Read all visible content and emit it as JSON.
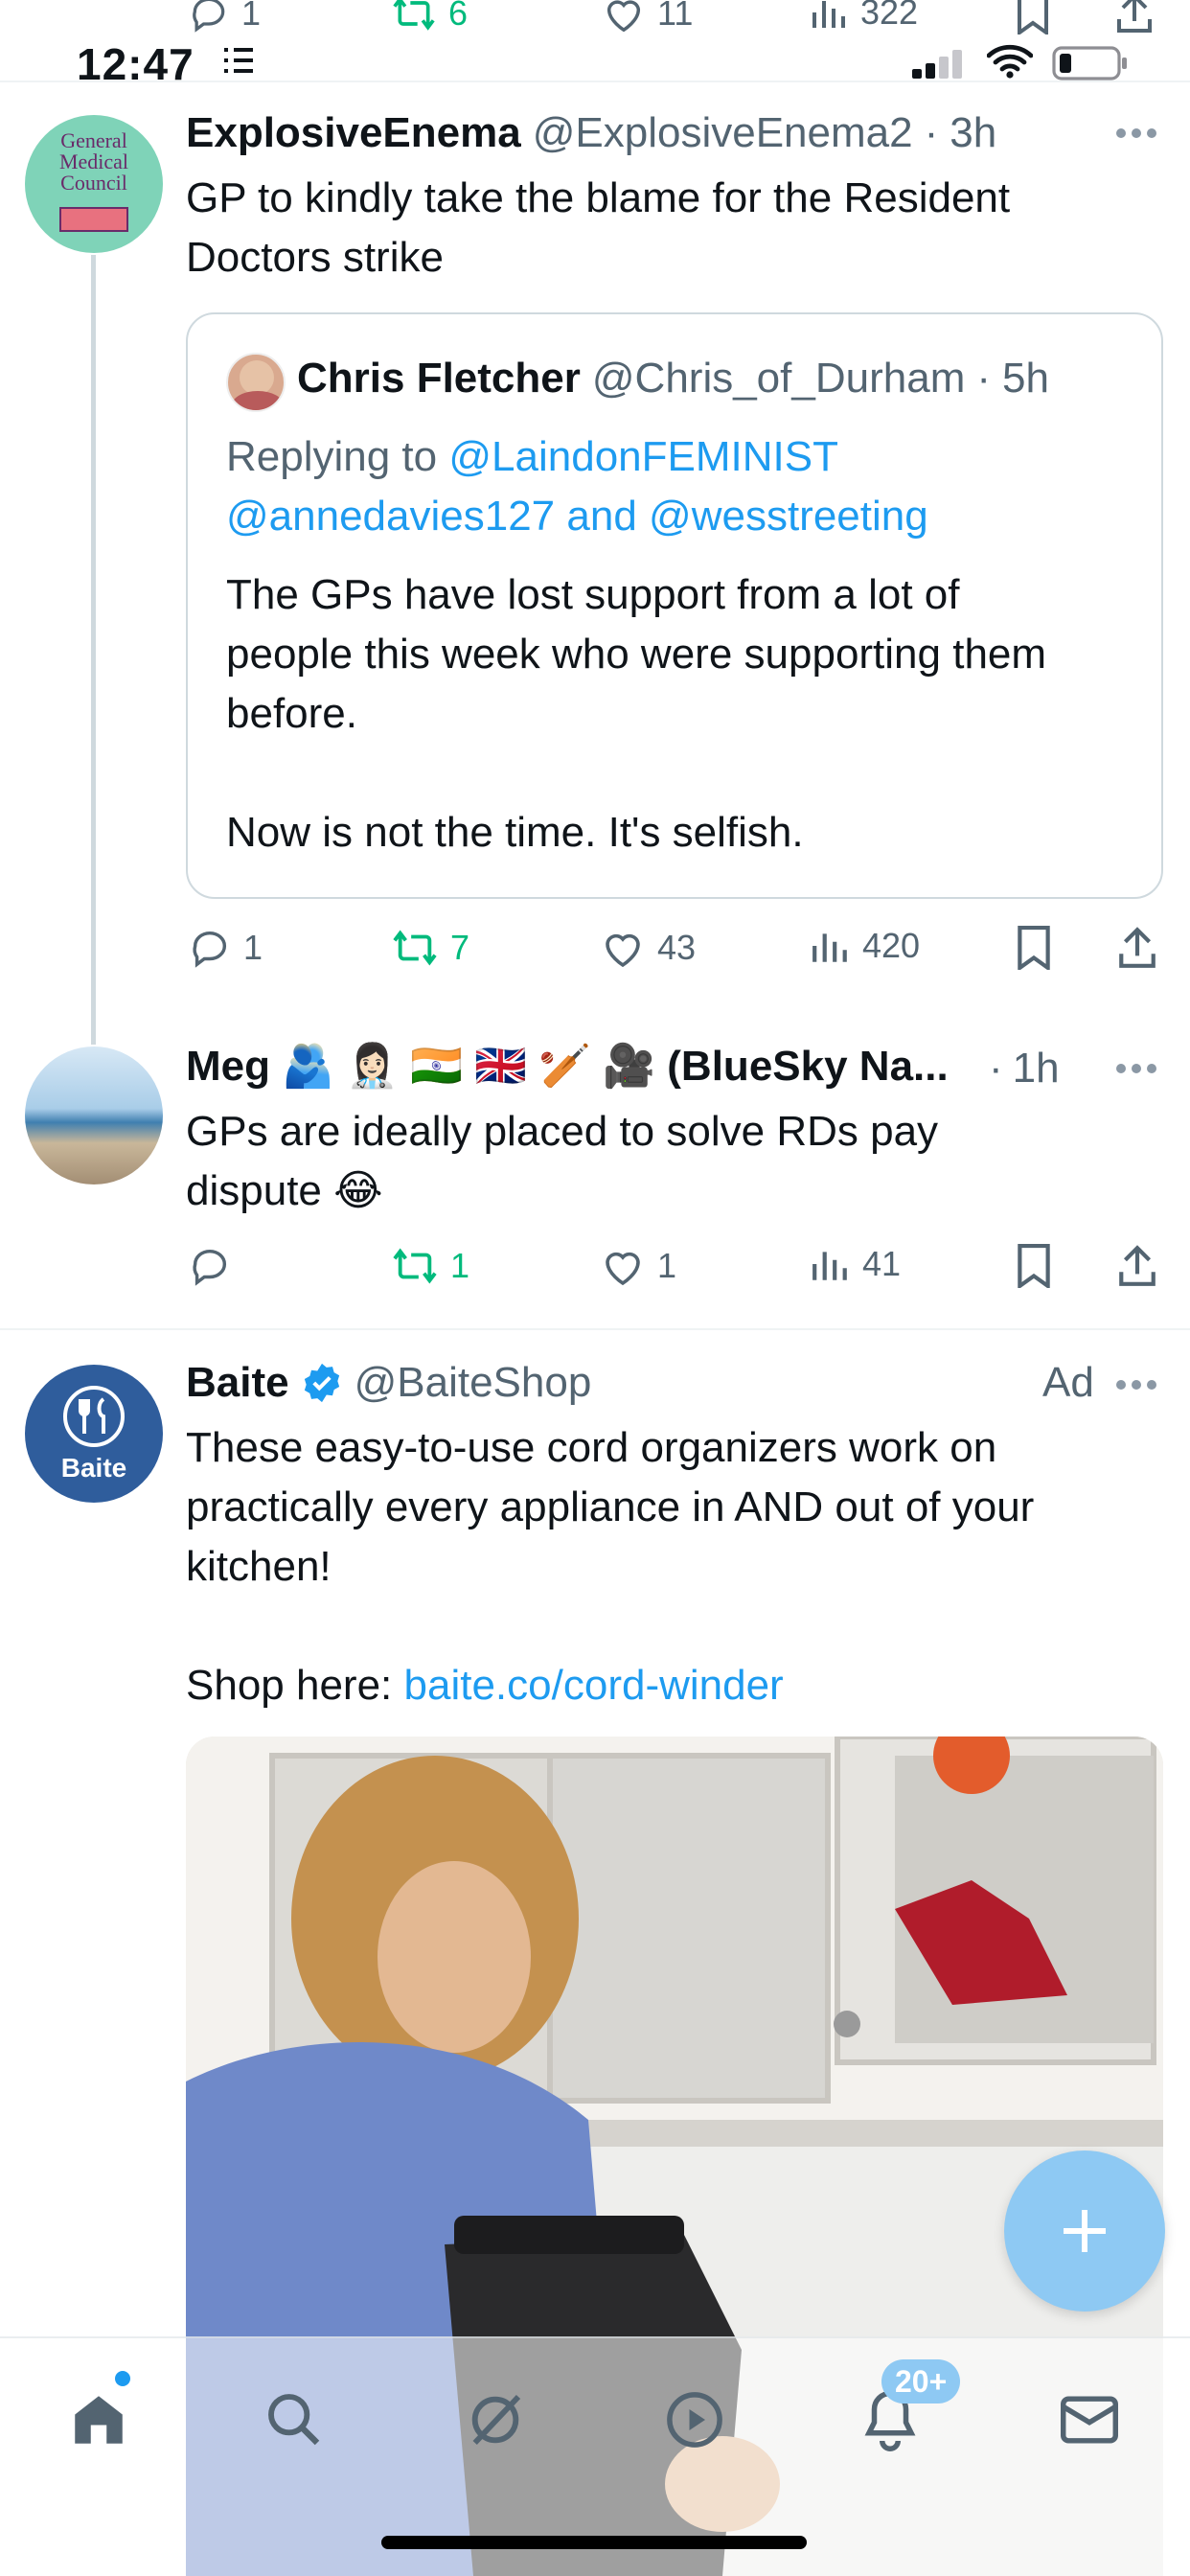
{
  "status_bar": {
    "time": "12:47"
  },
  "previous_tweet_actions": {
    "replies": "1",
    "reposts": "6",
    "likes": "11",
    "views": "322"
  },
  "tweet1": {
    "display_name": "ExplosiveEnema",
    "handle": "@ExplosiveEnema2",
    "age": "3h",
    "avatar_text": [
      "General",
      "Medical",
      "Council"
    ],
    "text": "GP to kindly take the blame for the Resident Doctors strike",
    "quote": {
      "display_name": "Chris Fletcher",
      "handle": "@Chris_of_Durham",
      "age": "5h",
      "replying_prefix": "Replying to",
      "replying_1": "@LaindonFEMINIST",
      "replying_2": "@annedavies127",
      "replying_and": "and",
      "replying_3": "@wesstreeting",
      "text_1": "The GPs have lost support from a lot of people this week who were supporting them before.",
      "text_2": "Now is not the time. It's selfish."
    },
    "actions": {
      "replies": "1",
      "reposts": "7",
      "likes": "43",
      "views": "420"
    }
  },
  "tweet2": {
    "display_name": "Meg 🫂 👩🏻‍⚕️ 🇮🇳 🇬🇧 🏏 🎥 (BlueSky Na...",
    "age": "1h",
    "text": "GPs are ideally placed to solve RDs pay dispute 😂",
    "actions": {
      "replies": "",
      "reposts": "1",
      "likes": "1",
      "views": "41"
    }
  },
  "ad": {
    "display_name": "Baite",
    "handle": "@BaiteShop",
    "ad_label": "Ad",
    "avatar_text": "Baite",
    "text": "These easy-to-use cord organizers work on practically every appliance in AND out of your kitchen!",
    "shop_prefix": "Shop here:",
    "shop_link": "baite.co/cord-winder"
  },
  "nav": {
    "notifications_badge": "20+"
  },
  "colors": {
    "accent": "#1d9bf0",
    "repost_green": "#00ba7c",
    "muted": "#536471",
    "fab": "#8ec9f3"
  }
}
